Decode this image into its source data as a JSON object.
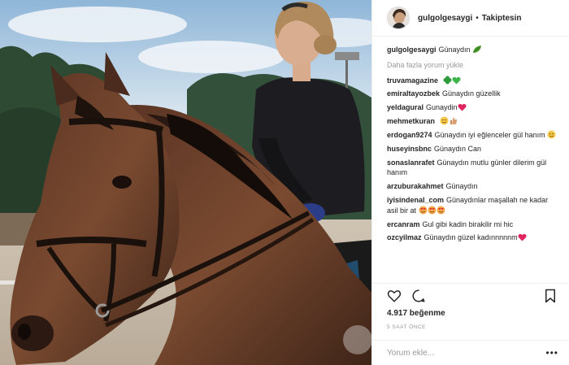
{
  "post": {
    "username": "gulgolgesaygi",
    "separator": "•",
    "follow_label": "Takiptesin",
    "caption": {
      "user": "gulgolgesaygi",
      "text": "Günaydın"
    },
    "load_more_label": "Daha fazla yorum yükle",
    "comments": [
      {
        "user": "truvamagazine",
        "text": ""
      },
      {
        "user": "emiraltayozbek",
        "text": "Günaydın güzellik"
      },
      {
        "user": "yeldagural",
        "text": "Gunaydin"
      },
      {
        "user": "mehmetkuran",
        "text": ""
      },
      {
        "user": "erdogan9274",
        "text": "Günaydın iyi eğlenceler gül hanım"
      },
      {
        "user": "huseyinsbnc",
        "text": "Günaydın Can"
      },
      {
        "user": "sonaslanrafet",
        "text": "Günaydın mutlu günler dilerim gül hanım"
      },
      {
        "user": "arzuburakahmet",
        "text": "Günaydın"
      },
      {
        "user": "iyisindenal_com",
        "text": "Günaydınlar maşallah ne kadar asil bir at"
      },
      {
        "user": "ercanram",
        "text": "Gul gibi kadin birakilir mi hic"
      },
      {
        "user": "ozcyilmaz",
        "text": "Günaydın güzel kadınnnnnm"
      }
    ],
    "likes_label": "4.917 beğenme",
    "time_label": "5 SAAT ÖNCE",
    "comment_placeholder": "Yorum ekle...",
    "more_label": "•••"
  },
  "icons": {
    "heart": "heart-icon",
    "comment": "comment-bubble-icon",
    "bookmark": "bookmark-icon",
    "more": "more-options-icon"
  },
  "colors": {
    "text": "#262626",
    "muted": "#999999",
    "border": "#efefef",
    "heart_red": "#e0245e",
    "clover_green": "#2e9b3a"
  }
}
